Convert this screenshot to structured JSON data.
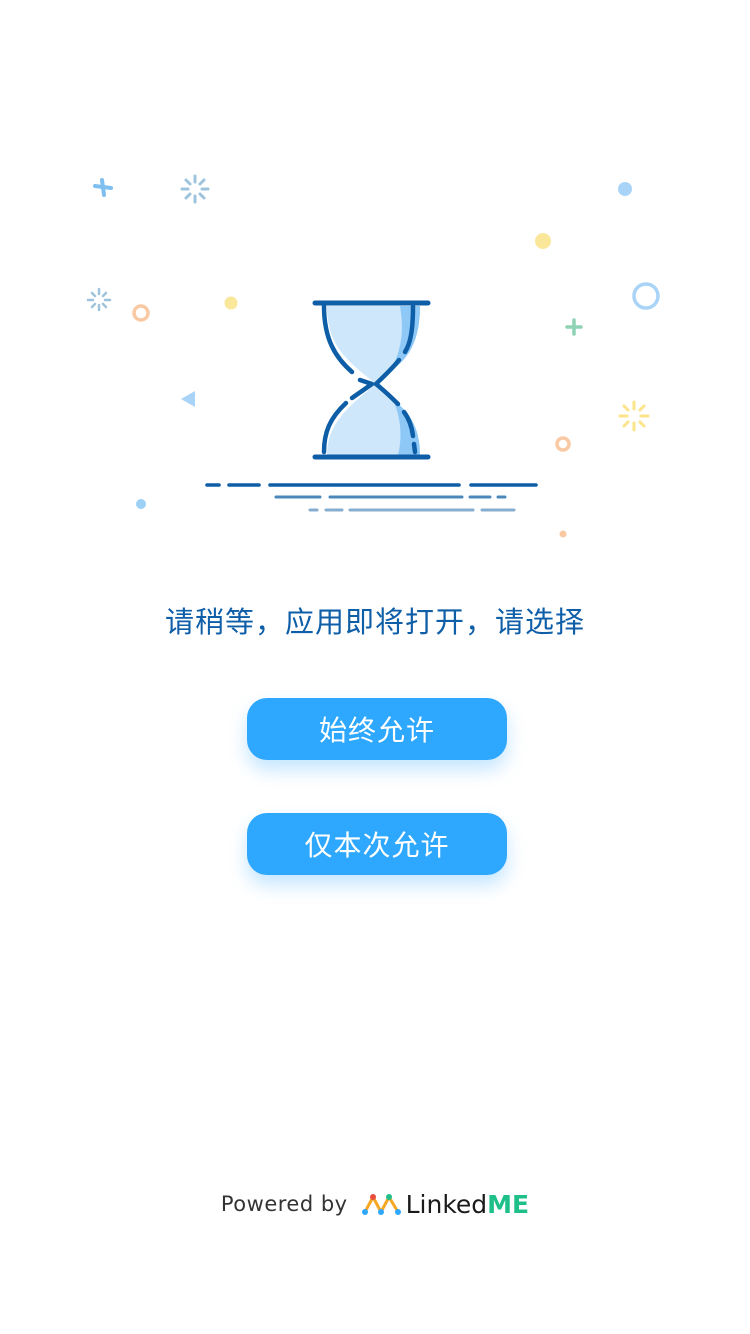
{
  "colors": {
    "primary_text": "#0f5ea8",
    "button": "#2ea7ff",
    "button_text": "#ffffff",
    "hourglass_stroke": "#0d5ea6",
    "hourglass_fill": "#cfe7fb",
    "brand_green": "#1fbf8a"
  },
  "illustration": {
    "main_icon": "hourglass-icon",
    "decorations": [
      "sparkle-icon",
      "circle-icon",
      "plus-icon",
      "triangle-icon",
      "dot-icon"
    ]
  },
  "prompt_text": "请稍等，应用即将打开，请选择",
  "buttons": {
    "always_allow": "始终允许",
    "allow_once": "仅本次允许"
  },
  "footer": {
    "powered_by": "Powered by",
    "brand_part1": "Linked",
    "brand_part2": "ME",
    "brand_icon": "linkedme-logo-icon"
  }
}
